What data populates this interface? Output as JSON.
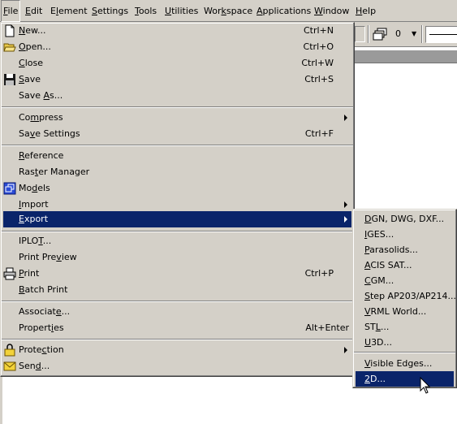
{
  "menubar": {
    "items": [
      {
        "pre": "",
        "key": "F",
        "post": "ile"
      },
      {
        "pre": "",
        "key": "E",
        "post": "dit"
      },
      {
        "pre": "E",
        "key": "l",
        "post": "ement"
      },
      {
        "pre": "",
        "key": "S",
        "post": "ettings"
      },
      {
        "pre": "",
        "key": "T",
        "post": "ools"
      },
      {
        "pre": "",
        "key": "U",
        "post": "tilities"
      },
      {
        "pre": "Wor",
        "key": "k",
        "post": "space"
      },
      {
        "pre": "",
        "key": "A",
        "post": "pplications"
      },
      {
        "pre": "",
        "key": "W",
        "post": "indow"
      },
      {
        "pre": "",
        "key": "H",
        "post": "elp"
      }
    ]
  },
  "toolbar": {
    "layer_count": "0",
    "caret": "▼"
  },
  "file_menu": {
    "items": [
      {
        "pre": "",
        "key": "N",
        "post": "ew...",
        "shortcut": "Ctrl+N",
        "icon": "new-document-icon"
      },
      {
        "pre": "",
        "key": "O",
        "post": "pen...",
        "shortcut": "Ctrl+O",
        "icon": "open-folder-icon"
      },
      {
        "pre": "",
        "key": "C",
        "post": "lose",
        "shortcut": "Ctrl+W",
        "icon": ""
      },
      {
        "pre": "",
        "key": "S",
        "post": "ave",
        "shortcut": "Ctrl+S",
        "icon": "floppy-disk-icon"
      },
      {
        "pre": "Save ",
        "key": "A",
        "post": "s...",
        "shortcut": "",
        "icon": ""
      },
      {
        "pre": "Co",
        "key": "m",
        "post": "press",
        "shortcut": "",
        "icon": "",
        "submenu": true
      },
      {
        "pre": "Sa",
        "key": "v",
        "post": "e Settings",
        "shortcut": "Ctrl+F",
        "icon": ""
      },
      {
        "pre": "",
        "key": "R",
        "post": "eference",
        "shortcut": "",
        "icon": ""
      },
      {
        "pre": "Ras",
        "key": "t",
        "post": "er Manager",
        "shortcut": "",
        "icon": ""
      },
      {
        "pre": "Mo",
        "key": "d",
        "post": "els",
        "shortcut": "",
        "icon": "models-icon"
      },
      {
        "pre": "",
        "key": "I",
        "post": "mport",
        "shortcut": "",
        "icon": "",
        "submenu": true
      },
      {
        "pre": "",
        "key": "E",
        "post": "xport",
        "shortcut": "",
        "icon": "",
        "submenu": true,
        "highlighted": true
      },
      {
        "pre": "IPLO",
        "key": "T",
        "post": "...",
        "shortcut": "",
        "icon": ""
      },
      {
        "pre": "Print Pre",
        "key": "v",
        "post": "iew",
        "shortcut": "",
        "icon": ""
      },
      {
        "pre": "",
        "key": "P",
        "post": "rint",
        "shortcut": "Ctrl+P",
        "icon": "printer-icon"
      },
      {
        "pre": "",
        "key": "B",
        "post": "atch Print",
        "shortcut": "",
        "icon": ""
      },
      {
        "pre": "Associat",
        "key": "e",
        "post": "...",
        "shortcut": "",
        "icon": ""
      },
      {
        "pre": "Propert",
        "key": "i",
        "post": "es",
        "shortcut": "Alt+Enter",
        "icon": ""
      },
      {
        "pre": "Prote",
        "key": "c",
        "post": "tion",
        "shortcut": "",
        "icon": "padlock-icon",
        "submenu": true
      },
      {
        "pre": "Sen",
        "key": "d",
        "post": "...",
        "shortcut": "",
        "icon": "envelope-icon"
      }
    ]
  },
  "export_menu": {
    "items": [
      {
        "pre": "",
        "key": "D",
        "post": "GN, DWG, DXF..."
      },
      {
        "pre": "",
        "key": "I",
        "post": "GES..."
      },
      {
        "pre": "",
        "key": "P",
        "post": "arasolids..."
      },
      {
        "pre": "",
        "key": "A",
        "post": "CIS SAT..."
      },
      {
        "pre": "",
        "key": "C",
        "post": "GM..."
      },
      {
        "pre": "",
        "key": "S",
        "post": "tep AP203/AP214..."
      },
      {
        "pre": "",
        "key": "V",
        "post": "RML World..."
      },
      {
        "pre": "ST",
        "key": "L",
        "post": "..."
      },
      {
        "pre": "",
        "key": "U",
        "post": "3D..."
      },
      {
        "pre": "",
        "key": "V",
        "post": "isible Edges..."
      },
      {
        "pre": "",
        "key": "2",
        "post": "D...",
        "highlighted": true
      }
    ]
  }
}
